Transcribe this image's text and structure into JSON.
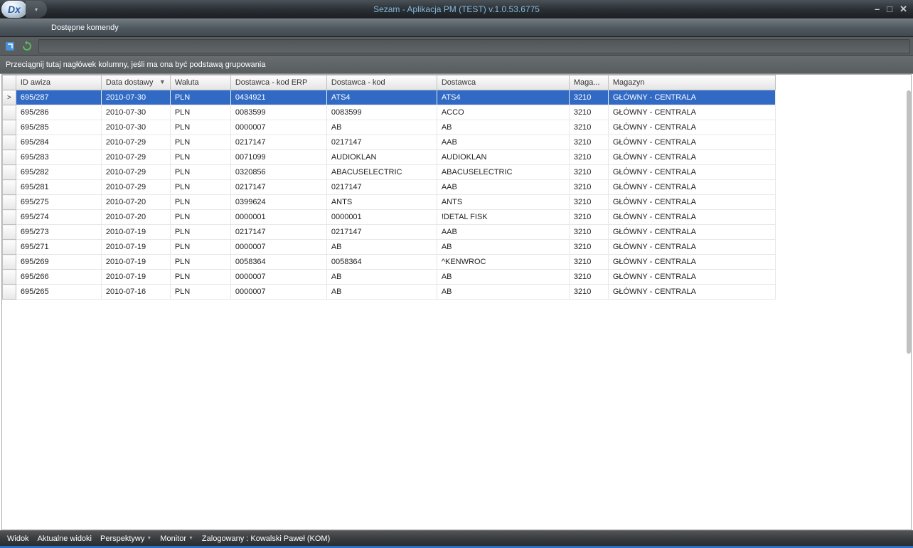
{
  "window": {
    "title": "Sezam - Aplikacja PM (TEST) v.1.0.53.6775",
    "app_icon_text": "Dx"
  },
  "ribbon": {
    "label": "Dostępne komendy"
  },
  "group_bar": {
    "hint": "Przeciągnij tutaj nagłówek kolumny, jeśli ma ona być podstawą grupowania"
  },
  "columns": {
    "id": "ID awiza",
    "date": "Data dostawy",
    "currency": "Waluta",
    "erp": "Dostawca - kod ERP",
    "kod": "Dostawca - kod",
    "supplier": "Dostawca",
    "maga": "Maga...",
    "magazyn": "Magazyn"
  },
  "rows": [
    {
      "id": "695/287",
      "date": "2010-07-30",
      "currency": "PLN",
      "erp": "0434921",
      "kod": "ATS4",
      "supplier": "ATS4",
      "maga": "3210",
      "magazyn": "GŁÓWNY - CENTRALA",
      "selected": true,
      "indicator": ">"
    },
    {
      "id": "695/286",
      "date": "2010-07-30",
      "currency": "PLN",
      "erp": "0083599",
      "kod": "0083599",
      "supplier": "ACCO",
      "maga": "3210",
      "magazyn": "GŁÓWNY - CENTRALA"
    },
    {
      "id": "695/285",
      "date": "2010-07-30",
      "currency": "PLN",
      "erp": "0000007",
      "kod": "AB",
      "supplier": "AB",
      "maga": "3210",
      "magazyn": "GŁÓWNY - CENTRALA"
    },
    {
      "id": "695/284",
      "date": "2010-07-29",
      "currency": "PLN",
      "erp": "0217147",
      "kod": "0217147",
      "supplier": "AAB",
      "maga": "3210",
      "magazyn": "GŁÓWNY - CENTRALA"
    },
    {
      "id": "695/283",
      "date": "2010-07-29",
      "currency": "PLN",
      "erp": "0071099",
      "kod": "AUDIOKLAN",
      "supplier": "AUDIOKLAN",
      "maga": "3210",
      "magazyn": "GŁÓWNY - CENTRALA"
    },
    {
      "id": "695/282",
      "date": "2010-07-29",
      "currency": "PLN",
      "erp": "0320856",
      "kod": "ABACUSELECTRIC",
      "supplier": "ABACUSELECTRIC",
      "maga": "3210",
      "magazyn": "GŁÓWNY - CENTRALA"
    },
    {
      "id": "695/281",
      "date": "2010-07-29",
      "currency": "PLN",
      "erp": "0217147",
      "kod": "0217147",
      "supplier": "AAB",
      "maga": "3210",
      "magazyn": "GŁÓWNY - CENTRALA"
    },
    {
      "id": "695/275",
      "date": "2010-07-20",
      "currency": "PLN",
      "erp": "0399624",
      "kod": "ANTS",
      "supplier": "ANTS",
      "maga": "3210",
      "magazyn": "GŁÓWNY - CENTRALA"
    },
    {
      "id": "695/274",
      "date": "2010-07-20",
      "currency": "PLN",
      "erp": "0000001",
      "kod": "0000001",
      "supplier": "!DETAL FISK",
      "maga": "3210",
      "magazyn": "GŁÓWNY - CENTRALA"
    },
    {
      "id": "695/273",
      "date": "2010-07-19",
      "currency": "PLN",
      "erp": "0217147",
      "kod": "0217147",
      "supplier": "AAB",
      "maga": "3210",
      "magazyn": "GŁÓWNY - CENTRALA"
    },
    {
      "id": "695/271",
      "date": "2010-07-19",
      "currency": "PLN",
      "erp": "0000007",
      "kod": "AB",
      "supplier": "AB",
      "maga": "3210",
      "magazyn": "GŁÓWNY - CENTRALA"
    },
    {
      "id": "695/269",
      "date": "2010-07-19",
      "currency": "PLN",
      "erp": "0058364",
      "kod": "0058364",
      "supplier": "^KENWROC",
      "maga": "3210",
      "magazyn": "GŁÓWNY - CENTRALA"
    },
    {
      "id": "695/266",
      "date": "2010-07-19",
      "currency": "PLN",
      "erp": "0000007",
      "kod": "AB",
      "supplier": "AB",
      "maga": "3210",
      "magazyn": "GŁÓWNY - CENTRALA"
    },
    {
      "id": "695/265",
      "date": "2010-07-16",
      "currency": "PLN",
      "erp": "0000007",
      "kod": "AB",
      "supplier": "AB",
      "maga": "3210",
      "magazyn": "GŁÓWNY - CENTRALA"
    }
  ],
  "status": {
    "widok": "Widok",
    "aktualne": "Aktualne widoki",
    "persp": "Perspektywy",
    "monitor": "Monitor",
    "zalog": "Zalogowany : Kowalski Paweł (KOM)"
  }
}
